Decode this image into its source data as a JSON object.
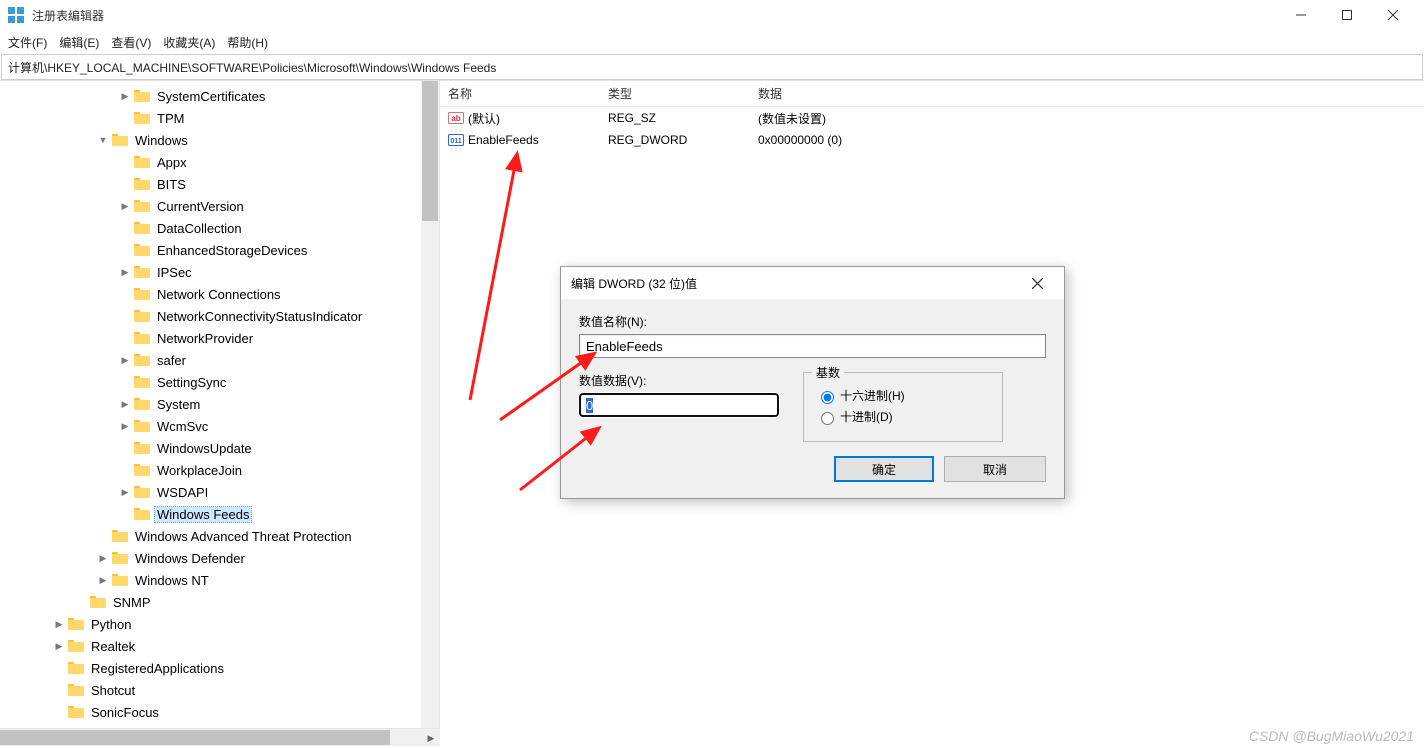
{
  "window": {
    "title": "注册表编辑器",
    "min": "minimize",
    "max": "maximize",
    "close": "close"
  },
  "menu": [
    "文件(F)",
    "编辑(E)",
    "查看(V)",
    "收藏夹(A)",
    "帮助(H)"
  ],
  "address": "计算机\\HKEY_LOCAL_MACHINE\\SOFTWARE\\Policies\\Microsoft\\Windows\\Windows Feeds",
  "tree": [
    {
      "depth": 5,
      "arrow": ">",
      "label": "SystemCertificates"
    },
    {
      "depth": 5,
      "arrow": "",
      "label": "TPM"
    },
    {
      "depth": 4,
      "arrow": "v",
      "label": "Windows"
    },
    {
      "depth": 5,
      "arrow": "",
      "label": "Appx"
    },
    {
      "depth": 5,
      "arrow": "",
      "label": "BITS"
    },
    {
      "depth": 5,
      "arrow": ">",
      "label": "CurrentVersion"
    },
    {
      "depth": 5,
      "arrow": "",
      "label": "DataCollection"
    },
    {
      "depth": 5,
      "arrow": "",
      "label": "EnhancedStorageDevices"
    },
    {
      "depth": 5,
      "arrow": ">",
      "label": "IPSec"
    },
    {
      "depth": 5,
      "arrow": "",
      "label": "Network Connections"
    },
    {
      "depth": 5,
      "arrow": "",
      "label": "NetworkConnectivityStatusIndicator"
    },
    {
      "depth": 5,
      "arrow": "",
      "label": "NetworkProvider"
    },
    {
      "depth": 5,
      "arrow": ">",
      "label": "safer"
    },
    {
      "depth": 5,
      "arrow": "",
      "label": "SettingSync"
    },
    {
      "depth": 5,
      "arrow": ">",
      "label": "System"
    },
    {
      "depth": 5,
      "arrow": ">",
      "label": "WcmSvc"
    },
    {
      "depth": 5,
      "arrow": "",
      "label": "WindowsUpdate"
    },
    {
      "depth": 5,
      "arrow": "",
      "label": "WorkplaceJoin"
    },
    {
      "depth": 5,
      "arrow": ">",
      "label": "WSDAPI"
    },
    {
      "depth": 5,
      "arrow": "",
      "label": "Windows Feeds",
      "selected": true
    },
    {
      "depth": 4,
      "arrow": "",
      "label": "Windows Advanced Threat Protection"
    },
    {
      "depth": 4,
      "arrow": ">",
      "label": "Windows Defender"
    },
    {
      "depth": 4,
      "arrow": ">",
      "label": "Windows NT"
    },
    {
      "depth": 3,
      "arrow": "",
      "label": "SNMP"
    },
    {
      "depth": 2,
      "arrow": ">",
      "label": "Python"
    },
    {
      "depth": 2,
      "arrow": ">",
      "label": "Realtek"
    },
    {
      "depth": 2,
      "arrow": "",
      "label": "RegisteredApplications"
    },
    {
      "depth": 2,
      "arrow": "",
      "label": "Shotcut"
    },
    {
      "depth": 2,
      "arrow": "",
      "label": "SonicFocus"
    }
  ],
  "list": {
    "headers": {
      "name": "名称",
      "type": "类型",
      "data": "数据"
    },
    "rows": [
      {
        "icon": "ab",
        "name": "(默认)",
        "type": "REG_SZ",
        "data": "(数值未设置)"
      },
      {
        "icon": "bin",
        "name": "EnableFeeds",
        "type": "REG_DWORD",
        "data": "0x00000000 (0)"
      }
    ]
  },
  "dialog": {
    "title": "编辑 DWORD (32 位)值",
    "nameLabel": "数值名称(N):",
    "nameValue": "EnableFeeds",
    "dataLabel": "数值数据(V):",
    "dataValue": "0",
    "baseLabel": "基数",
    "radioHex": "十六进制(H)",
    "radioDec": "十进制(D)",
    "ok": "确定",
    "cancel": "取消"
  },
  "watermark": "CSDN @BugMiaoWu2021"
}
